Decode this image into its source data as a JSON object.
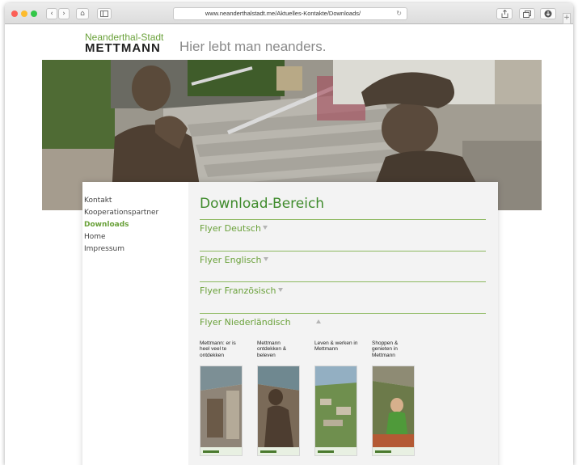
{
  "browser": {
    "url": "www.neanderthalstadt.me/Aktuelles-Kontakte/Downloads/",
    "back_label": "‹",
    "forward_label": "›",
    "home_label": "⌂",
    "reload_label": "↻"
  },
  "site": {
    "logo_top": "Neanderthal-Stadt",
    "logo_main": "METTMANN",
    "tagline": "Hier lebt man neanders."
  },
  "sidebar": {
    "items": [
      {
        "label": "Kontakt"
      },
      {
        "label": "Kooperationspartner"
      },
      {
        "label": "Downloads"
      },
      {
        "label": "Home"
      },
      {
        "label": "Impressum"
      }
    ]
  },
  "main": {
    "title": "Download-Bereich",
    "sections": [
      {
        "label": "Flyer Deutsch",
        "expanded": false
      },
      {
        "label": "Flyer Englisch",
        "expanded": false
      },
      {
        "label": "Flyer Französisch",
        "expanded": false
      },
      {
        "label": "Flyer Niederländisch",
        "expanded": true
      }
    ],
    "flyers": [
      {
        "title": "Mettmann: er is heel veel te ontdekken"
      },
      {
        "title": "Mettmann ontdekken & beleven"
      },
      {
        "title": "Leven & werken in Mettmann"
      },
      {
        "title": "Shoppen & genieten in Mettmann"
      }
    ]
  },
  "colors": {
    "accent_green": "#6aa13a",
    "heading_green": "#3f8b2c",
    "rule_green": "#8cb85f"
  }
}
